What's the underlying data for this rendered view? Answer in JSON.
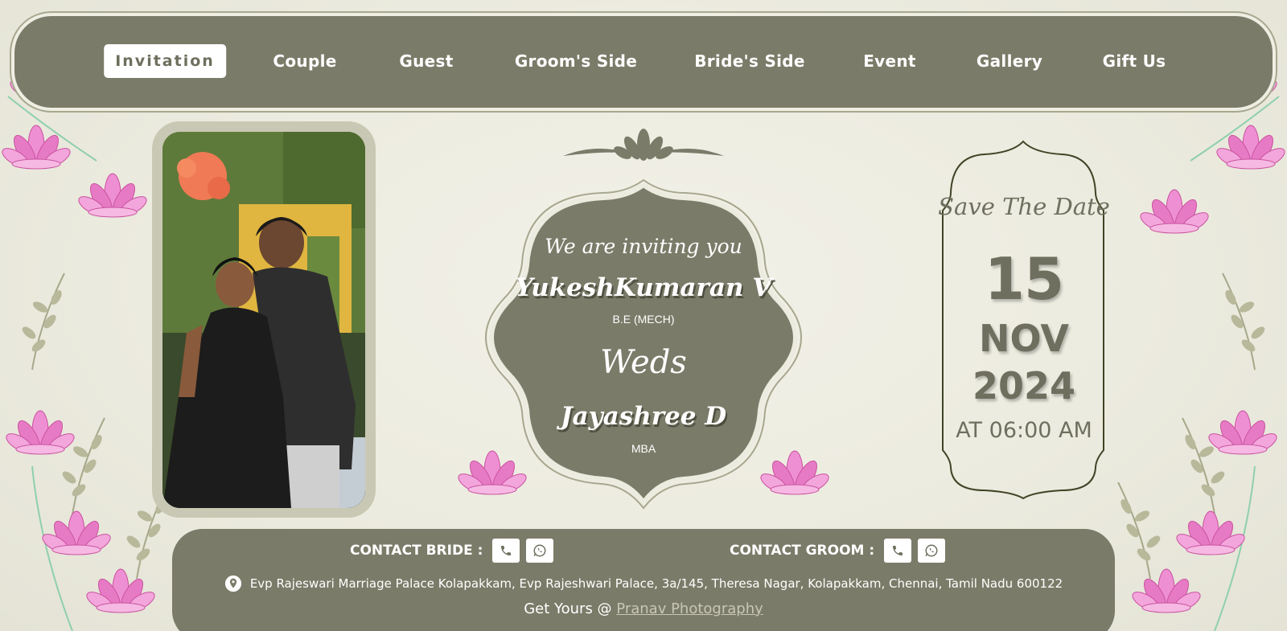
{
  "colors": {
    "olive": "#7b7b69",
    "olive_text": "#6f6f5f",
    "cream": "#ecebdf",
    "lotus_pink": "#e879c8"
  },
  "nav": {
    "items": [
      {
        "label": "Invitation",
        "active": true
      },
      {
        "label": "Couple"
      },
      {
        "label": "Guest"
      },
      {
        "label": "Groom's Side"
      },
      {
        "label": "Bride's Side"
      },
      {
        "label": "Event"
      },
      {
        "label": "Gallery"
      },
      {
        "label": "Gift Us"
      }
    ]
  },
  "invite": {
    "line": "We are inviting you",
    "groom_name": "YukeshKumaran V",
    "groom_degree": "B.E (MECH)",
    "weds": "Weds",
    "bride_name": "Jayashree D",
    "bride_degree": "MBA"
  },
  "save_date": {
    "title": "Save The Date",
    "day": "15",
    "month": "NOV",
    "year": "2024",
    "time": "AT 06:00 AM"
  },
  "footer": {
    "contact_bride": "CONTACT BRIDE :",
    "contact_groom": "CONTACT GROOM :",
    "address": "Evp Rajeswari Marriage Palace Kolapakkam, Evp Rajeshwari Palace, 3a/145, Theresa Nagar, Kolapakkam, Chennai, Tamil Nadu 600122",
    "credit_prefix": "Get Yours @ ",
    "credit_link": "Pranav Photography"
  },
  "icons": [
    "phone-icon",
    "whatsapp-icon",
    "location-pin-icon",
    "lotus-icon"
  ]
}
